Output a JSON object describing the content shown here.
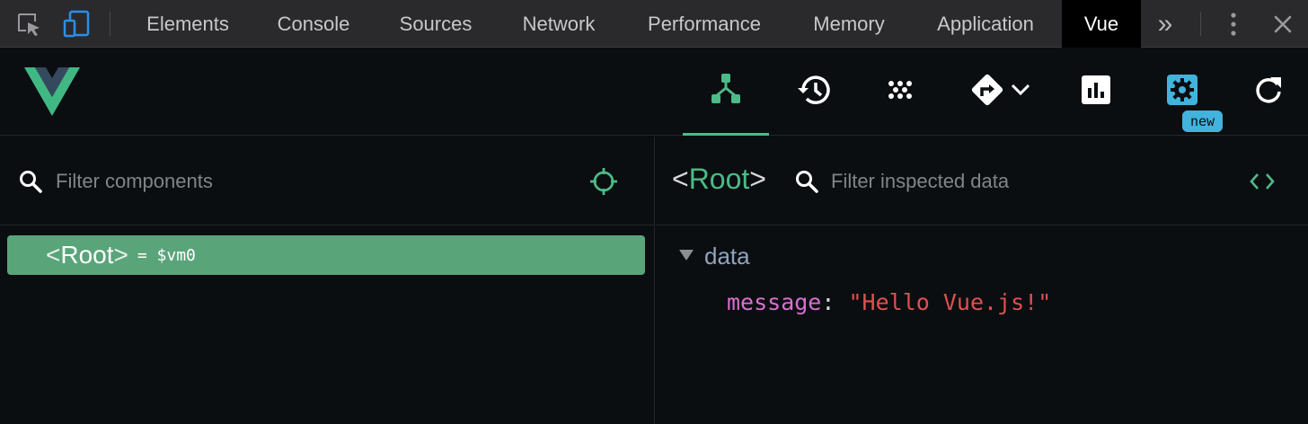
{
  "devtools": {
    "tabs": [
      "Elements",
      "Console",
      "Sources",
      "Network",
      "Performance",
      "Memory",
      "Application",
      "Vue"
    ],
    "active_tab": "Vue",
    "icons": [
      "inspect-element-icon",
      "device-toolbar-icon",
      "more-tabs-icon",
      "kebab-menu-icon",
      "close-icon"
    ],
    "more_tabs_glyph": "»"
  },
  "vue": {
    "logo": "vue-logo",
    "toolbar": [
      "components-tree-icon",
      "history-icon",
      "vuex-icon",
      "router-icon",
      "performance-icon",
      "settings-icon",
      "refresh-icon"
    ],
    "new_badge": "new",
    "colors": {
      "accent": "#4dba87",
      "selected_row": "#5aa47a",
      "badge": "#41b3dd"
    }
  },
  "left": {
    "filter_placeholder": "Filter components",
    "tree": [
      {
        "open_bracket": "<",
        "name": "Root",
        "close_bracket": ">",
        "vm": "= $vm0"
      }
    ]
  },
  "right": {
    "title_open": "<",
    "title_name": "Root",
    "title_close": ">",
    "filter_placeholder": "Filter inspected data",
    "section": "data",
    "props": [
      {
        "key": "message",
        "colon": ":",
        "value": "\"Hello Vue.js!\""
      }
    ]
  }
}
